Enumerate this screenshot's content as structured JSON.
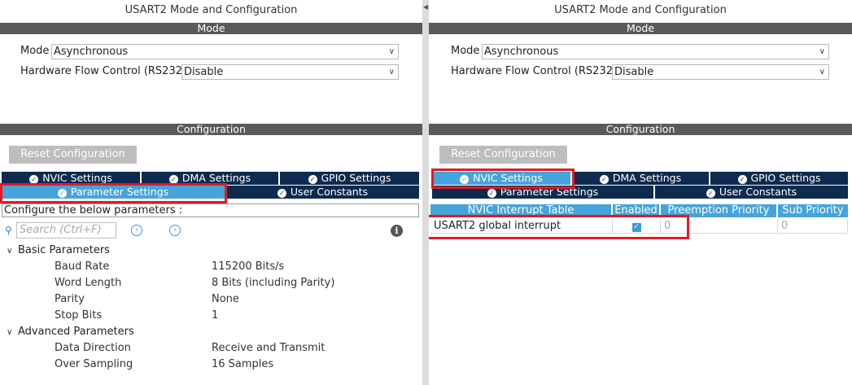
{
  "left": {
    "title": "USART2 Mode and Configuration",
    "mode_header": "Mode",
    "mode_label": "Mode",
    "mode_value": "Asynchronous",
    "hfc_label": "Hardware Flow Control (RS232)",
    "hfc_value": "Disable",
    "config_header": "Configuration",
    "reset_label": "Reset Configuration",
    "tabs_row1": [
      "NVIC Settings",
      "DMA Settings",
      "GPIO Settings"
    ],
    "tabs_row2": [
      "Parameter Settings",
      "User Constants"
    ],
    "active_tab": "Parameter Settings",
    "configure_text": "Configure the below parameters :",
    "search_placeholder": "Search (Ctrl+F)",
    "groups": [
      {
        "name": "Basic Parameters",
        "params": [
          {
            "name": "Baud Rate",
            "value": "115200 Bits/s"
          },
          {
            "name": "Word Length",
            "value": "8 Bits (including Parity)"
          },
          {
            "name": "Parity",
            "value": "None"
          },
          {
            "name": "Stop Bits",
            "value": "1"
          }
        ]
      },
      {
        "name": "Advanced Parameters",
        "params": [
          {
            "name": "Data Direction",
            "value": "Receive and Transmit"
          },
          {
            "name": "Over Sampling",
            "value": "16 Samples"
          }
        ]
      }
    ]
  },
  "right": {
    "title": "USART2 Mode and Configuration",
    "mode_header": "Mode",
    "mode_label": "Mode",
    "mode_value": "Asynchronous",
    "hfc_label": "Hardware Flow Control (RS232)",
    "hfc_value": "Disable",
    "config_header": "Configuration",
    "reset_label": "Reset Configuration",
    "tabs_row1": [
      "NVIC Settings",
      "DMA Settings",
      "GPIO Settings"
    ],
    "tabs_row2": [
      "Parameter Settings",
      "User Constants"
    ],
    "active_tab": "NVIC Settings",
    "nvic_headers": [
      "NVIC Interrupt Table",
      "Enabled",
      "Preemption Priority",
      "Sub Priority"
    ],
    "nvic_rows": [
      {
        "name": "USART2 global interrupt",
        "enabled": true,
        "preemption": "0",
        "sub": "0"
      }
    ]
  },
  "colors": {
    "tab_bg": "#0e2a4e",
    "tab_active": "#46a4db",
    "highlight_box": "#e01b24",
    "section_header": "#5a5a5a"
  }
}
